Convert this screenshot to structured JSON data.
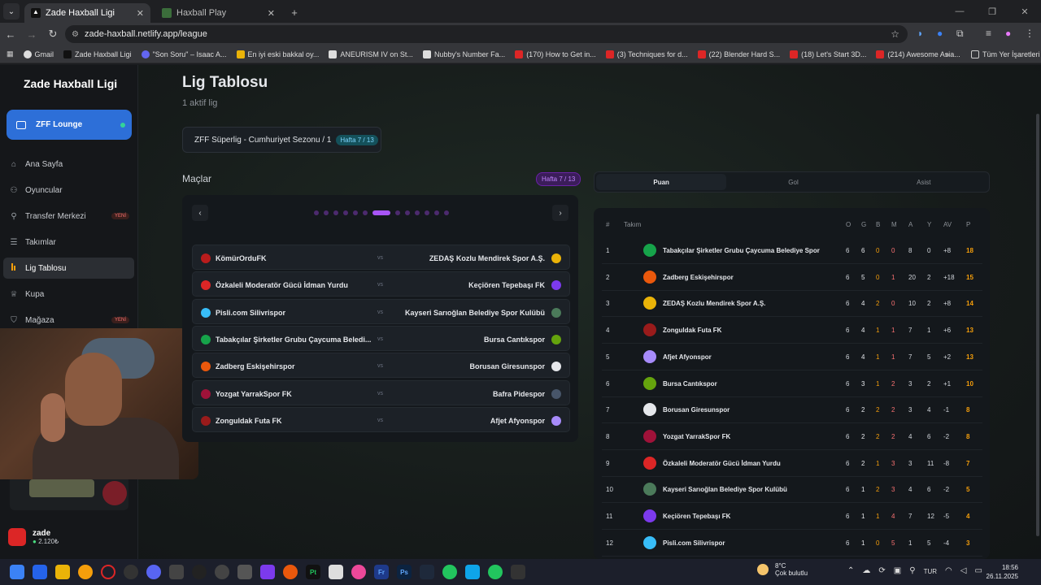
{
  "browser": {
    "tabs": [
      {
        "label": "Zade Haxball Ligi",
        "active": true
      },
      {
        "label": "Haxball Play",
        "active": false
      }
    ],
    "url": "zade-haxball.netlify.app/league",
    "bookmarks": [
      "Gmail",
      "Zade Haxball Ligi",
      "\"Son Soru\" – Isaac A...",
      "En iyi eski bakkal oy...",
      "ANEURISM IV on St...",
      "Nubby's Number Fa...",
      "(170) How to Get in...",
      "(3) Techniques for d...",
      "(22) Blender Hard S...",
      "(18) Let's Start 3D...",
      "(214) Awesome Asia..."
    ],
    "all_bookmarks": "Tüm Yer İşaretleri"
  },
  "sidebar": {
    "logo": "Zade Haxball Ligi",
    "lounge": "ZFF Lounge",
    "items": [
      {
        "label": "Ana Sayfa",
        "icon": "home-icon"
      },
      {
        "label": "Oyuncular",
        "icon": "users-icon"
      },
      {
        "label": "Transfer Merkezi",
        "icon": "search-icon",
        "badge": "YENİ"
      },
      {
        "label": "Takımlar",
        "icon": "menu-icon"
      },
      {
        "label": "Lig Tablosu",
        "icon": "chart-icon",
        "active": true
      },
      {
        "label": "Kupa",
        "icon": "trophy-icon"
      },
      {
        "label": "Mağaza",
        "icon": "bag-icon",
        "badge": "YENİ"
      }
    ],
    "user": {
      "name": "zade",
      "balance": "2.120₺"
    }
  },
  "main": {
    "title": "Lig Tablosu",
    "subtitle": "1 aktif lig",
    "season": "ZFF Süperlig - Cumhuriyet Sezonu / 1",
    "season_badge": "Hafta 7 / 13",
    "matches_title": "Maçlar",
    "matches_badge": "Hafta 7 / 13",
    "vs": "vs",
    "matches": [
      {
        "home": "KömürOrduFK",
        "away": "ZEDAŞ Kozlu Mendirek Spor A.Ş.",
        "hc": "#b91c1c",
        "ac": "#eab308"
      },
      {
        "home": "Özkaleli Moderatör Gücü İdman Yurdu",
        "away": "Keçiören Tepebaşı FK",
        "hc": "#dc2626",
        "ac": "#7c3aed"
      },
      {
        "home": "Pisli.com Silivrispor",
        "away": "Kayseri Sarıoğlan Belediye Spor Kulübü",
        "hc": "#38bdf8",
        "ac": "#4b7a5a"
      },
      {
        "home": "Tabakçılar Şirketler Grubu Çaycuma Beledi...",
        "away": "Bursa Cantıkspor",
        "hc": "#16a34a",
        "ac": "#65a30d"
      },
      {
        "home": "Zadberg Eskişehirspor",
        "away": "Borusan Giresunspor",
        "hc": "#ea580c",
        "ac": "#e5e7eb"
      },
      {
        "home": "Yozgat YarrakSpor FK",
        "away": "Bafra Pidespor",
        "hc": "#9f1239",
        "ac": "#475569"
      },
      {
        "home": "Zonguldak Futa FK",
        "away": "Afjet Afyonspor",
        "hc": "#991b1b",
        "ac": "#a78bfa"
      }
    ],
    "stat_tabs": [
      "Puan",
      "Gol",
      "Asist"
    ],
    "table_headers": {
      "rank": "#",
      "team": "Takım",
      "o": "O",
      "g": "G",
      "b": "B",
      "m": "M",
      "a": "A",
      "y": "Y",
      "av": "AV",
      "p": "P"
    },
    "standings": [
      {
        "rank": "1",
        "team": "Tabakçılar Şirketler Grubu Çaycuma Belediye Spor",
        "o": "6",
        "g": "6",
        "b": "0",
        "m": "0",
        "a": "8",
        "y": "0",
        "av": "+8",
        "p": "18",
        "c": "#16a34a"
      },
      {
        "rank": "2",
        "team": "Zadberg Eskişehirspor",
        "o": "6",
        "g": "5",
        "b": "0",
        "m": "1",
        "a": "20",
        "y": "2",
        "av": "+18",
        "p": "15",
        "c": "#ea580c"
      },
      {
        "rank": "3",
        "team": "ZEDAŞ Kozlu Mendirek Spor A.Ş.",
        "o": "6",
        "g": "4",
        "b": "2",
        "m": "0",
        "a": "10",
        "y": "2",
        "av": "+8",
        "p": "14",
        "c": "#eab308"
      },
      {
        "rank": "4",
        "team": "Zonguldak Futa FK",
        "o": "6",
        "g": "4",
        "b": "1",
        "m": "1",
        "a": "7",
        "y": "1",
        "av": "+6",
        "p": "13",
        "c": "#991b1b"
      },
      {
        "rank": "5",
        "team": "Afjet Afyonspor",
        "o": "6",
        "g": "4",
        "b": "1",
        "m": "1",
        "a": "7",
        "y": "5",
        "av": "+2",
        "p": "13",
        "c": "#a78bfa"
      },
      {
        "rank": "6",
        "team": "Bursa Cantıkspor",
        "o": "6",
        "g": "3",
        "b": "1",
        "m": "2",
        "a": "3",
        "y": "2",
        "av": "+1",
        "p": "10",
        "c": "#65a30d"
      },
      {
        "rank": "7",
        "team": "Borusan Giresunspor",
        "o": "6",
        "g": "2",
        "b": "2",
        "m": "2",
        "a": "3",
        "y": "4",
        "av": "-1",
        "p": "8",
        "c": "#e5e7eb"
      },
      {
        "rank": "8",
        "team": "Yozgat YarrakSpor FK",
        "o": "6",
        "g": "2",
        "b": "2",
        "m": "2",
        "a": "4",
        "y": "6",
        "av": "-2",
        "p": "8",
        "c": "#9f1239"
      },
      {
        "rank": "9",
        "team": "Özkaleli Moderatör Gücü İdman Yurdu",
        "o": "6",
        "g": "2",
        "b": "1",
        "m": "3",
        "a": "3",
        "y": "11",
        "av": "-8",
        "p": "7",
        "c": "#dc2626"
      },
      {
        "rank": "10",
        "team": "Kayseri Sarıoğlan Belediye Spor Kulübü",
        "o": "6",
        "g": "1",
        "b": "2",
        "m": "3",
        "a": "4",
        "y": "6",
        "av": "-2",
        "p": "5",
        "c": "#4b7a5a"
      },
      {
        "rank": "11",
        "team": "Keçiören Tepebaşı FK",
        "o": "6",
        "g": "1",
        "b": "1",
        "m": "4",
        "a": "7",
        "y": "12",
        "av": "-5",
        "p": "4",
        "c": "#7c3aed"
      },
      {
        "rank": "12",
        "team": "Pisli.com Silivrispor",
        "o": "6",
        "g": "1",
        "b": "0",
        "m": "5",
        "a": "1",
        "y": "5",
        "av": "-4",
        "p": "3",
        "c": "#38bdf8"
      }
    ]
  },
  "taskbar": {
    "weather_temp": "8°C",
    "weather_desc": "Çok bulutlu",
    "weather_badge": "8",
    "lang": "TUR",
    "time": "18:56",
    "date": "26.11.2025"
  }
}
